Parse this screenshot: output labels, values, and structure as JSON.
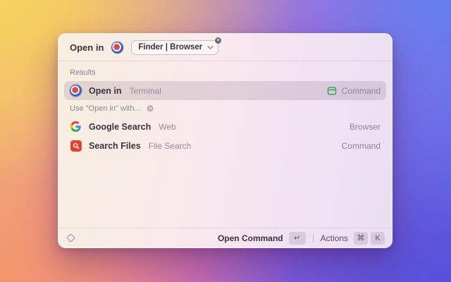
{
  "header": {
    "title": "Open in",
    "pill_label": "Finder | Browser"
  },
  "sections": [
    {
      "label": "Results",
      "items": [
        {
          "title": "Open in",
          "subtitle": "Terminal",
          "accessory": "Command"
        }
      ]
    },
    {
      "label": "Use \"Open in\" with...",
      "items": [
        {
          "title": "Google Search",
          "subtitle": "Web",
          "accessory": "Browser"
        },
        {
          "title": "Search Files",
          "subtitle": "File Search",
          "accessory": "Command"
        }
      ]
    }
  ],
  "footer": {
    "primary_label": "Open Command",
    "primary_key": "↵",
    "secondary_label": "Actions",
    "key_cmd": "⌘",
    "key_k": "K"
  },
  "icons": {
    "gear": "⚙"
  },
  "colors": {
    "accessory_green": "#2fae5f",
    "search_files_red": "#e8402f",
    "google_blue": "#4285F4",
    "google_red": "#EA4335",
    "google_yellow": "#FBBC05",
    "google_green": "#34A853"
  }
}
